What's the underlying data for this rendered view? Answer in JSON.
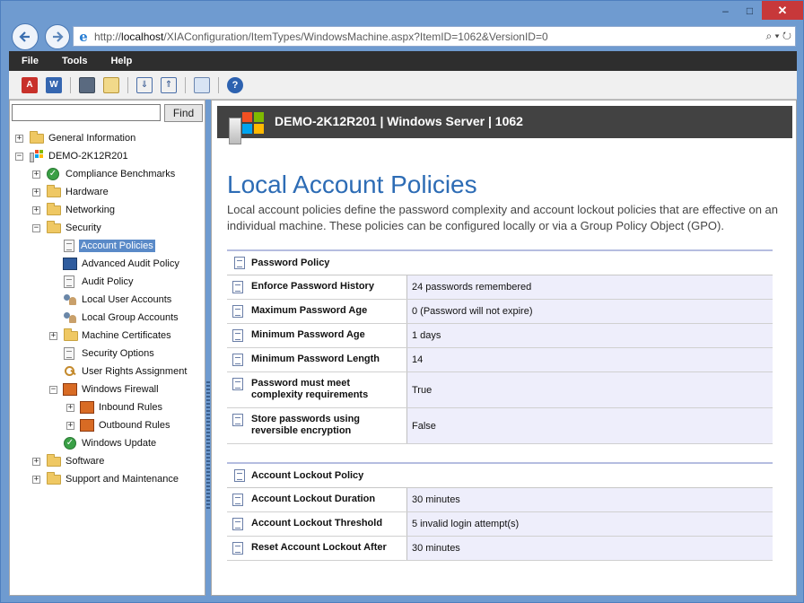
{
  "browser": {
    "url_prefix": "http://",
    "url_host": "localhost",
    "url_path": "/XIAConfiguration/ItemTypes/WindowsMachine.aspx?ItemID=1062&VersionID=0",
    "address_tools": "⌕ ▾ ↻",
    "window_buttons": {
      "minimize": "–",
      "maximize": "□",
      "close": "✕"
    }
  },
  "menubar": {
    "items": [
      "File",
      "Tools",
      "Help"
    ]
  },
  "toolbar": {
    "buttons": [
      "pdf-export-icon",
      "word-export-icon",
      "save-icon",
      "edit-icon",
      "expand-all-icon",
      "collapse-all-icon",
      "compare-icon",
      "help-icon"
    ]
  },
  "search": {
    "value": "",
    "button": "Find"
  },
  "tree": [
    {
      "label": "General Information"
    },
    {
      "label": "DEMO-2K12R201"
    },
    {
      "label": "Compliance Benchmarks"
    },
    {
      "label": "Hardware"
    },
    {
      "label": "Networking"
    },
    {
      "label": "Security"
    },
    {
      "label": "Account Policies"
    },
    {
      "label": "Advanced Audit Policy"
    },
    {
      "label": "Audit Policy"
    },
    {
      "label": "Local User Accounts"
    },
    {
      "label": "Local Group Accounts"
    },
    {
      "label": "Machine Certificates"
    },
    {
      "label": "Security Options"
    },
    {
      "label": "User Rights Assignment"
    },
    {
      "label": "Windows Firewall"
    },
    {
      "label": "Inbound Rules"
    },
    {
      "label": "Outbound Rules"
    },
    {
      "label": "Windows Update"
    },
    {
      "label": "Software"
    },
    {
      "label": "Support and Maintenance"
    }
  ],
  "content": {
    "header": "DEMO-2K12R201 | Windows Server | 1062",
    "title": "Local Account Policies",
    "intro": "Local account policies define the password complexity and account lockout policies that are effective on an individual machine. These policies can be configured locally or via a Group Policy Object (GPO).",
    "password_policy": {
      "heading": "Password Policy",
      "rows": [
        {
          "name": "Enforce Password History",
          "value": "24 passwords remembered"
        },
        {
          "name": "Maximum Password Age",
          "value": "0 (Password will not expire)"
        },
        {
          "name": "Minimum Password Age",
          "value": "1 days"
        },
        {
          "name": "Minimum Password Length",
          "value": "14"
        },
        {
          "name": "Password must meet complexity requirements",
          "value": "True"
        },
        {
          "name": "Store passwords using reversible encryption",
          "value": "False"
        }
      ]
    },
    "lockout_policy": {
      "heading": "Account Lockout Policy",
      "rows": [
        {
          "name": "Account Lockout Duration",
          "value": "30 minutes"
        },
        {
          "name": "Account Lockout Threshold",
          "value": "5 invalid login attempt(s)"
        },
        {
          "name": "Reset Account Lockout After",
          "value": "30 minutes"
        }
      ]
    }
  },
  "colors": {
    "accent": "#2d6cb5",
    "menubar": "#2e2e2e",
    "selected": "#5a8ac8",
    "frame": "#6f9bd0"
  }
}
